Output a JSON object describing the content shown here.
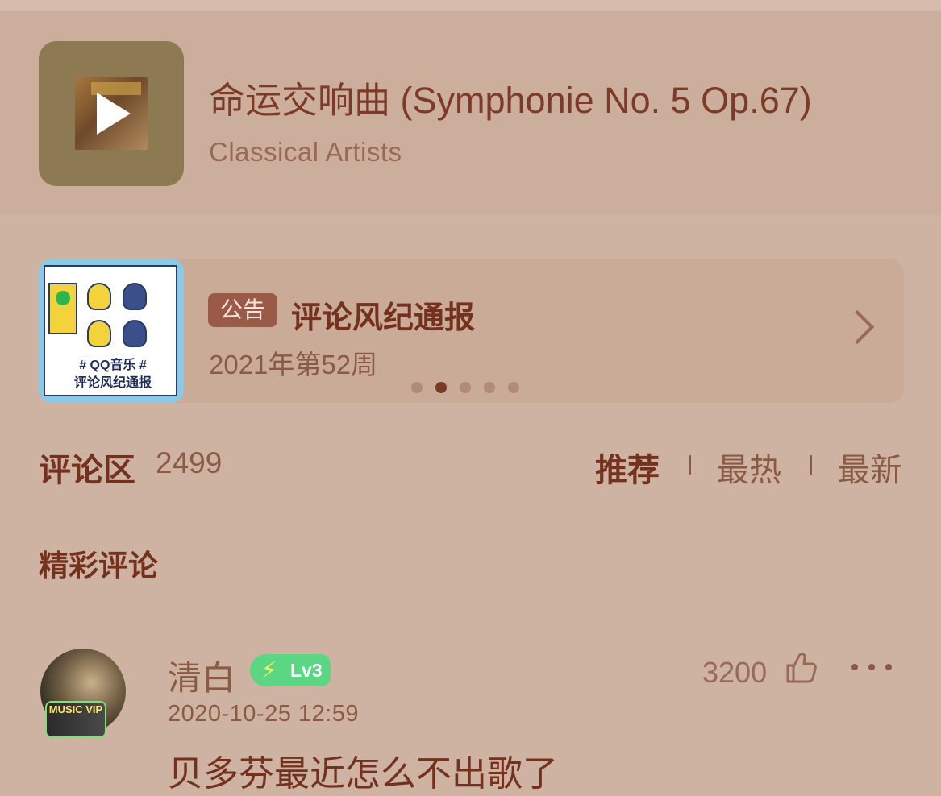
{
  "song": {
    "title": "命运交响曲 (Symphonie No. 5 Op.67)",
    "artist": "Classical Artists",
    "cover_icon": "play-icon"
  },
  "notice": {
    "badge": "公告",
    "title": "评论风纪通报",
    "date": "2021年第52周",
    "thumb_caption_1": "# QQ音乐 #",
    "thumb_caption_2": "评论风纪通报",
    "pager_total": 5,
    "pager_active": 2,
    "chevron_icon": "chevron-right-icon"
  },
  "comments": {
    "label": "评论区",
    "count": "2499",
    "sort_tabs": [
      {
        "label": "推荐",
        "active": true
      },
      {
        "label": "最热",
        "active": false
      },
      {
        "label": "最新",
        "active": false
      }
    ],
    "section_label": "精彩评论",
    "items": [
      {
        "username": "清白",
        "level": "Lv3",
        "avatar_badge": "MUSIC VIP",
        "timestamp": "2020-10-25 12:59",
        "likes": "3200",
        "text": "贝多芬最近怎么不出歌了"
      }
    ]
  },
  "colors": {
    "background": "#cfb3a2",
    "accent_text": "#74321e",
    "secondary_text": "#8b5a45",
    "level_badge": "#5bd682"
  }
}
